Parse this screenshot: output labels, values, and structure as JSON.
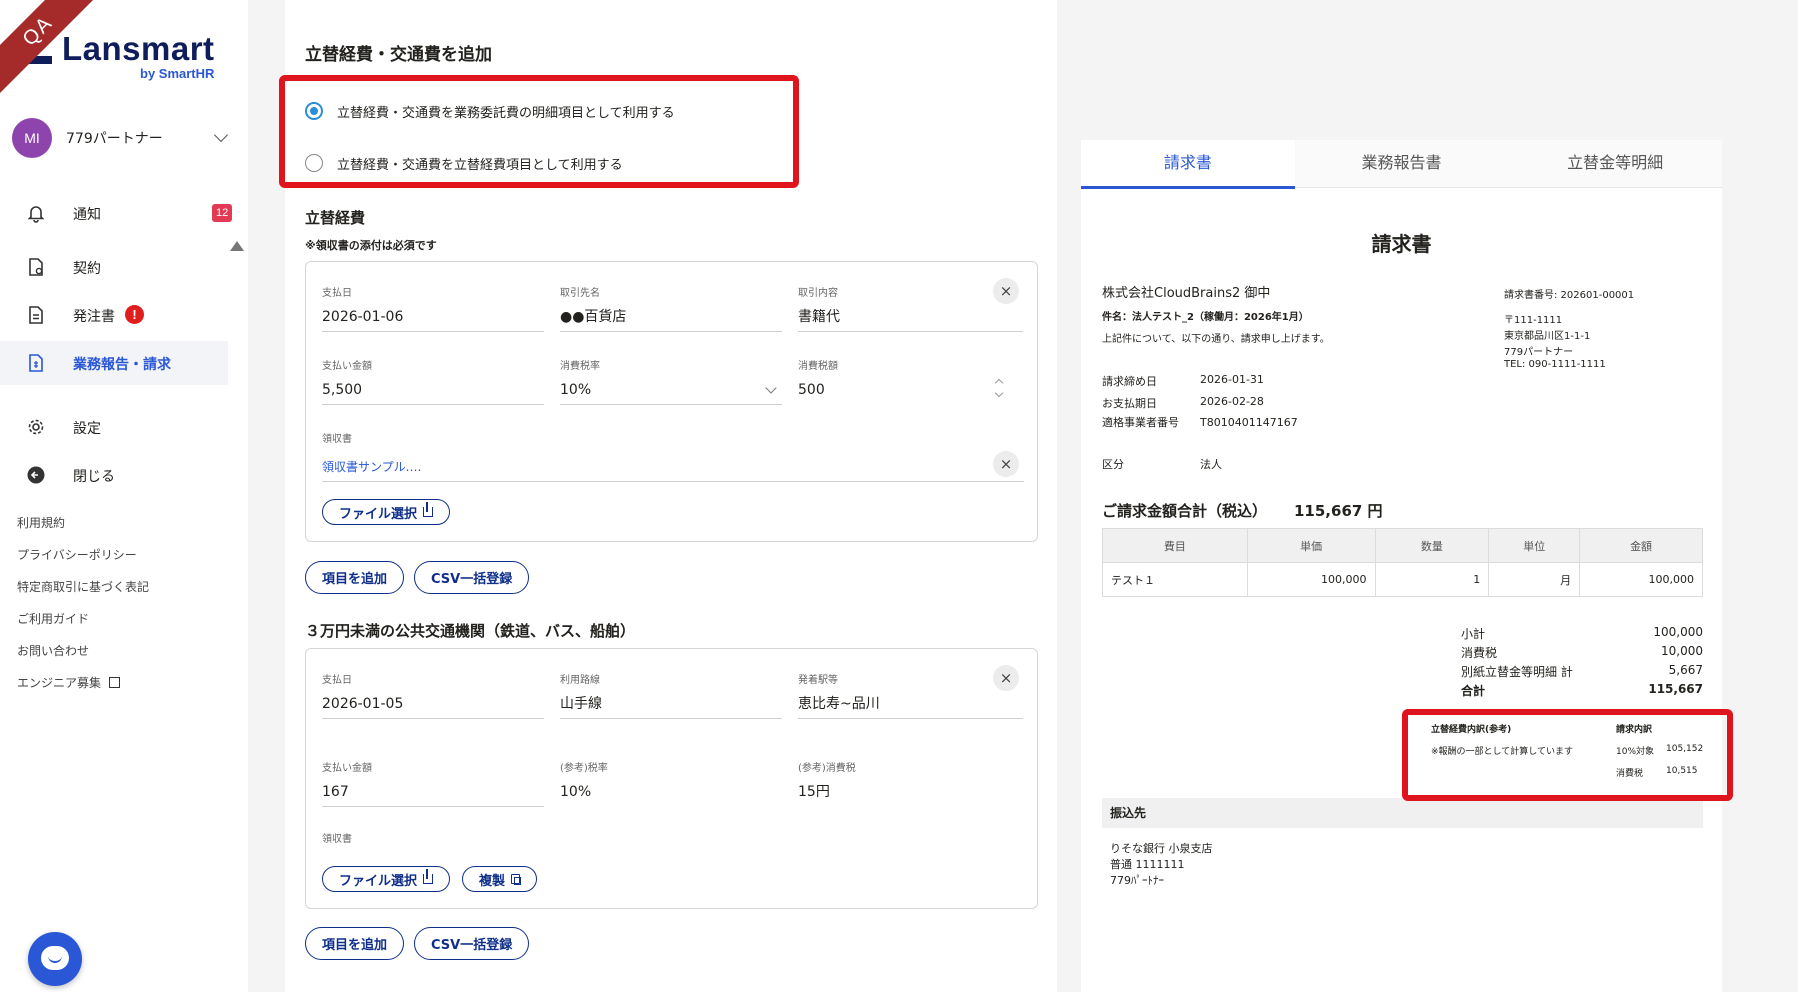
{
  "ribbon": "QA",
  "brand": {
    "name": "Lansmart",
    "sub": "by SmartHR"
  },
  "account": {
    "initials": "MI",
    "name": "779パートナー"
  },
  "nav": {
    "notifications": {
      "label": "通知",
      "badge": "12"
    },
    "contract": {
      "label": "契約"
    },
    "orders": {
      "label": "発注書",
      "alert": "!"
    },
    "reports": {
      "label": "業務報告・請求"
    },
    "settings": {
      "label": "設定"
    },
    "close": {
      "label": "閉じる"
    }
  },
  "footer_links": [
    "利用規約",
    "プライバシーポリシー",
    "特定商取引に基づく表記",
    "ご利用ガイド",
    "お問い合わせ",
    "エンジニア募集"
  ],
  "colors": {
    "accent": "#2a57d6",
    "highlight": "#e0141c",
    "navy": "#0f1e5a"
  },
  "form": {
    "title": "立替経費・交通費を追加",
    "radio_option_1": "立替経費・交通費を業務委託費の明細項目として利用する",
    "radio_option_2": "立替経費・交通費を立替経費項目として利用する",
    "selected_option": 1,
    "expense": {
      "title": "立替経費",
      "note": "※領収書の添付は必須です",
      "labels": {
        "date": "支払日",
        "payee": "取引先名",
        "content": "取引内容",
        "amount": "支払い金額",
        "tax_rate": "消費税率",
        "tax": "消費税額",
        "receipt": "領収書"
      },
      "values": {
        "date": "2026-01-06",
        "payee": "●●百貨店",
        "content": "書籍代",
        "amount": "5,500",
        "tax_rate": "10%",
        "tax": "500",
        "receipt_file": "領収書サンプル.…"
      },
      "file_button": "ファイル選択",
      "add_button": "項目を追加",
      "csv_button": "CSV一括登録"
    },
    "transport": {
      "title": "３万円未満の公共交通機関（鉄道、バス、船舶）",
      "labels": {
        "date": "支払日",
        "route": "利用路線",
        "stations": "発着駅等",
        "amount": "支払い金額",
        "tax_rate": "(参考)税率",
        "tax": "(参考)消費税",
        "receipt": "領収書"
      },
      "values": {
        "date": "2026-01-05",
        "route": "山手線",
        "stations": "恵比寿~品川",
        "amount": "167",
        "tax_rate": "10%",
        "tax": "15円"
      },
      "file_button": "ファイル選択",
      "copy_button": "複製",
      "add_button": "項目を追加",
      "csv_button": "CSV一括登録"
    }
  },
  "preview": {
    "tabs": [
      "請求書",
      "業務報告書",
      "立替金等明細"
    ],
    "active_tab": 0,
    "title": "請求書",
    "client": "株式会社CloudBrains2 御中",
    "subject": "件名：法人テスト_2（稼働月：2026年1月）",
    "intro": "上記件について、以下の通り、請求申し上げます。",
    "invoice_no": "請求書番号: 202601-00001",
    "issuer": [
      "〒111-1111",
      "東京都品川区1-1-1",
      "779パートナー",
      "TEL: 090-1111-1111"
    ],
    "meta": [
      {
        "k": "請求締め日",
        "v": "2026-01-31"
      },
      {
        "k": "お支払期日",
        "v": "2026-02-28"
      },
      {
        "k": "適格事業者番号",
        "v": "T8010401147167"
      },
      {
        "k": "区分",
        "v": "法人"
      }
    ],
    "total_label": "ご請求金額合計（税込）",
    "total_value": "115,667 円",
    "table": {
      "headers": [
        "費目",
        "単価",
        "数量",
        "単位",
        "金額"
      ],
      "rows": [
        [
          "テスト１",
          "100,000",
          "1",
          "月",
          "100,000"
        ]
      ]
    },
    "summary": [
      {
        "k": "小計",
        "v": "100,000"
      },
      {
        "k": "消費税",
        "v": "10,000"
      },
      {
        "k": "別紙立替金等明細 計",
        "v": "5,667"
      },
      {
        "k": "合計",
        "v": "115,667"
      }
    ],
    "breakdown": {
      "title": "立替経費内訳(参考)",
      "note": "※報酬の一部として計算しています",
      "col_title": "請求内訳",
      "rows": [
        {
          "k": "10%対象",
          "v": "105,152"
        },
        {
          "k": "消費税",
          "v": "10,515"
        }
      ]
    },
    "bank": {
      "title": "振込先",
      "lines": [
        "りそな銀行 小泉支店",
        "普通 1111111",
        "779ﾊﾟｰﾄﾅｰ"
      ]
    }
  }
}
